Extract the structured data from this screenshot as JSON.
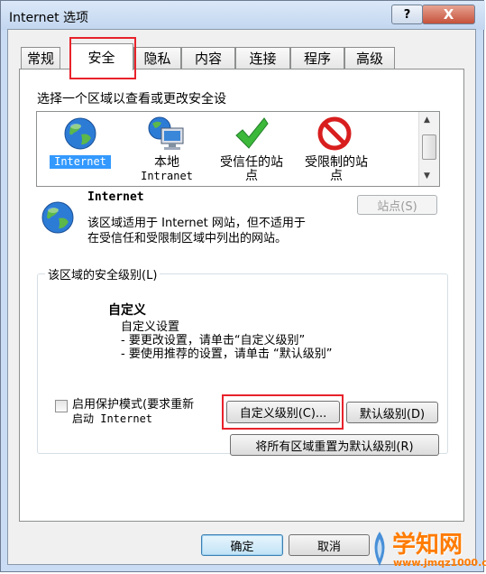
{
  "window": {
    "title": "Internet 选项",
    "help_symbol": "?",
    "close_symbol": "X"
  },
  "tabs": [
    {
      "label": "常规"
    },
    {
      "label": "安全",
      "active": true
    },
    {
      "label": "隐私"
    },
    {
      "label": "内容"
    },
    {
      "label": "连接"
    },
    {
      "label": "程序"
    },
    {
      "label": "高级"
    }
  ],
  "security": {
    "zone_prompt": "选择一个区域以查看或更改安全设",
    "zones": [
      {
        "label": "Internet",
        "selected": true,
        "icon": "globe-icon"
      },
      {
        "label_line1": "本地",
        "label_line2": "Intranet",
        "icon": "intranet-computer-icon"
      },
      {
        "label_line1": "受信任的站",
        "label_line2": "点",
        "icon": "green-check-icon"
      },
      {
        "label_line1": "受限制的站",
        "label_line2": "点",
        "icon": "restricted-icon"
      }
    ],
    "zone_title": "Internet",
    "zone_desc_line1": "该区域适用于 Internet 网站，但不适用于",
    "zone_desc_line2": "在受信任和受限制区域中列出的网站。",
    "sites_button": "站点(S)",
    "level_group_label": "该区域的安全级别(L)",
    "level_name": "自定义",
    "level_desc_line1": "自定义设置",
    "level_desc_line2": "- 要更改设置，请单击“自定义级别”",
    "level_desc_line3": "- 要使用推荐的设置，请单击 “默认级别”",
    "protected_mode_line1": "启用保护模式(要求重新",
    "protected_mode_line2": "启动 Internet",
    "custom_level_button": "自定义级别(C)...",
    "default_level_button": "默认级别(D)",
    "reset_all_button": "将所有区域重置为默认级别(R)"
  },
  "footer": {
    "ok_button": "确定",
    "cancel_button": "取消"
  },
  "watermark": {
    "brand": "学知网",
    "url": "www.jmqz1000.com"
  },
  "colors": {
    "highlight": "#e8222b",
    "selection": "#3399ff",
    "brand": "#ff7b00"
  }
}
